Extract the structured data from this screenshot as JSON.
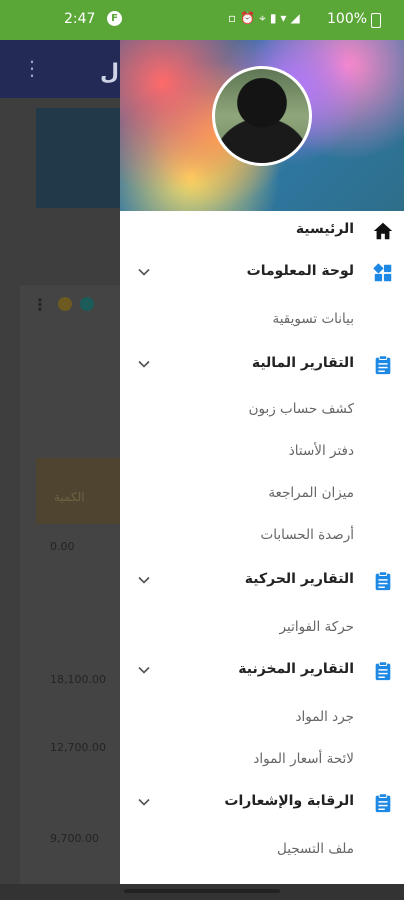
{
  "status_bar": {
    "time": "2:47",
    "app_badge": "F",
    "battery": "100%"
  },
  "background_app": {
    "title": "ل",
    "table_header": "الكمية",
    "values": [
      "0.00",
      "18,100.00",
      "12,700.00",
      "9,700.00"
    ]
  },
  "drawer": {
    "menu": [
      {
        "label": "الرئيسية",
        "icon": "home-icon",
        "type": "top"
      },
      {
        "label": "لوحة المعلومات",
        "icon": "dashboard-icon",
        "type": "section"
      },
      {
        "label": "بيانات تسويقية",
        "type": "sub"
      },
      {
        "label": "التقارير المالية",
        "icon": "clipboard-icon",
        "type": "section"
      },
      {
        "label": "كشف حساب زبون",
        "type": "sub"
      },
      {
        "label": "دفتر الأستاذ",
        "type": "sub"
      },
      {
        "label": "ميزان المراجعة",
        "type": "sub"
      },
      {
        "label": "أرصدة الحسابات",
        "type": "sub"
      },
      {
        "label": "التقارير الحركية",
        "icon": "clipboard-icon",
        "type": "section"
      },
      {
        "label": "حركة الفواتير",
        "type": "sub"
      },
      {
        "label": "التقارير المخزنية",
        "icon": "clipboard-icon",
        "type": "section"
      },
      {
        "label": "جرد المواد",
        "type": "sub"
      },
      {
        "label": "لائحة أسعار المواد",
        "type": "sub"
      },
      {
        "label": "الرقابة والإشعارات",
        "icon": "clipboard-icon",
        "type": "section"
      },
      {
        "label": "ملف التسجيل",
        "type": "sub"
      }
    ]
  },
  "colors": {
    "status_bar": "#5aa637",
    "accent": "#1e88e5"
  }
}
